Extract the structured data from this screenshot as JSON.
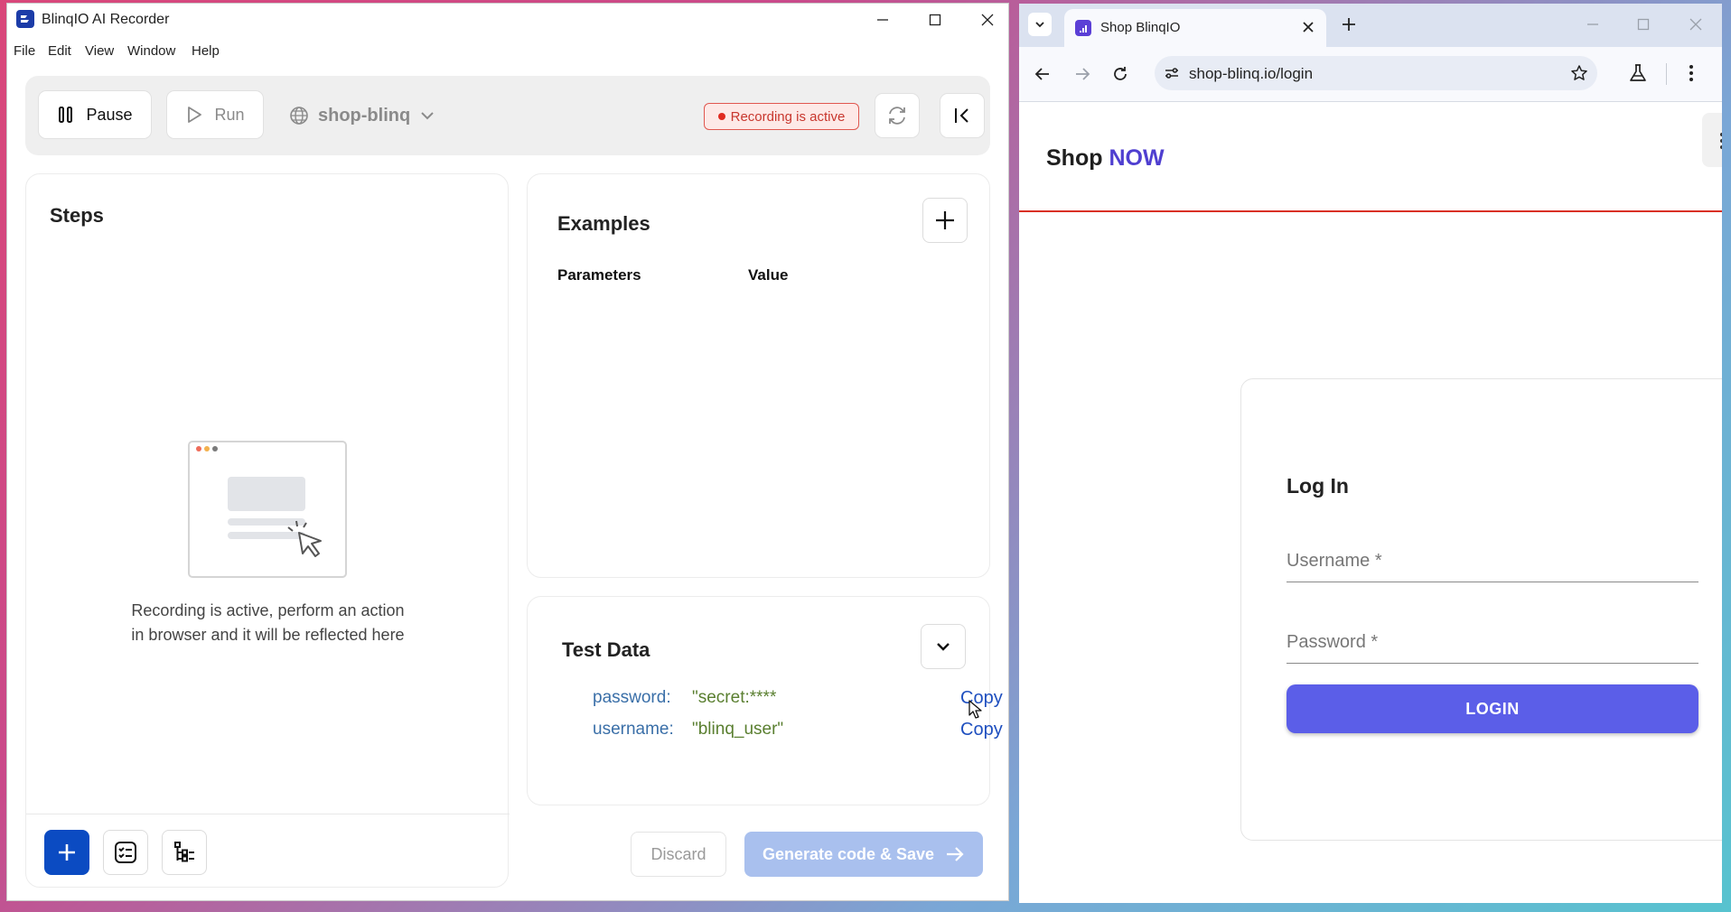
{
  "recorder": {
    "window_title": "BlinqIO AI Recorder",
    "menu": [
      "File",
      "Edit",
      "View",
      "Window",
      "Help"
    ],
    "toolbar": {
      "pause_label": "Pause",
      "run_label": "Run",
      "environment": "shop-blinq",
      "recording_status": "Recording is active"
    },
    "steps": {
      "title": "Steps",
      "empty_line1": "Recording is active, perform an action",
      "empty_line2": "in browser and it will be reflected here"
    },
    "examples": {
      "title": "Examples",
      "col_parameters": "Parameters",
      "col_value": "Value"
    },
    "test_data": {
      "title": "Test Data",
      "rows": [
        {
          "key": "password:",
          "value": "\"secret:****",
          "copy": "Copy"
        },
        {
          "key": "username:",
          "value": "\"blinq_user\"",
          "copy": "Copy"
        }
      ]
    },
    "footer": {
      "discard_label": "Discard",
      "generate_label": "Generate code & Save"
    },
    "colors": {
      "primary": "#0b4bc2",
      "generate_disabled": "#a9c0ee",
      "recording": "#e02b20"
    }
  },
  "browser": {
    "tab_title": "Shop BlinqIO",
    "url": "shop-blinq.io/login",
    "site": {
      "brand_part1": "Shop",
      "brand_part2": "NOW",
      "login_title": "Log In",
      "username_label": "Username *",
      "password_label": "Password *",
      "login_button": "LOGIN"
    },
    "colors": {
      "brand_accent": "#4f3fd0",
      "login_button": "#5b5ee8",
      "header_rule": "#d93025"
    }
  }
}
